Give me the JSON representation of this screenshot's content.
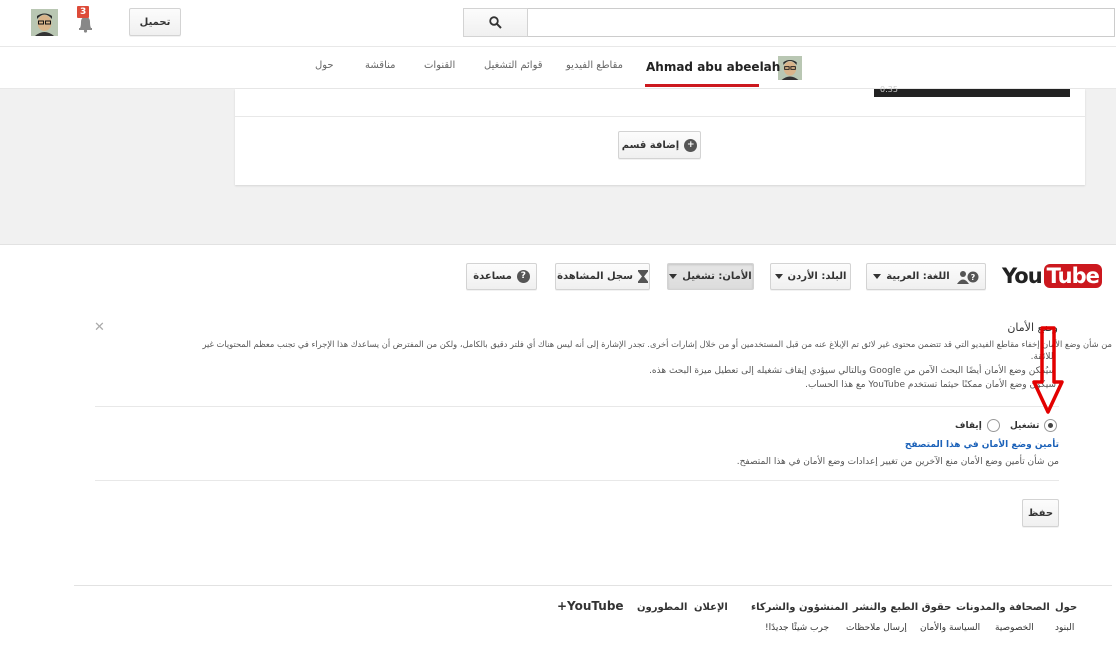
{
  "masthead": {
    "upload_label": "تحميل",
    "notification_count": "3",
    "search_placeholder": ""
  },
  "channel_nav": {
    "channel_name": "Ahmad abu abeelah",
    "tabs": [
      "مقاطع الفيديو",
      "قوائم التشغيل",
      "القنوات",
      "مناقشة",
      "حول"
    ]
  },
  "content": {
    "video_time": "0:35",
    "add_section_label": "إضافة قسم"
  },
  "footer_bar": {
    "logo_you": "You",
    "logo_tube": "Tube",
    "language_label": "اللغة: العربية",
    "country_label": "البلد: الأردن",
    "safety_label": "الأمان: تشغيل",
    "history_label": "سجل المشاهدة",
    "help_label": "مساعدة"
  },
  "safety_panel": {
    "title": "وضع الأمان",
    "p1_line1": "من شأن وضع الأمان إخفاء مقاطع الفيديو التي قد تتضمن محتوى غير لائق تم الإبلاغ عنه من قبل المستخدمين أو من خلال إشارات أخرى. تجدر الإشارة إلى أنه ليس هناك أي فلتر دقيق بالكامل، ولكن من المفترض أن يساعدك هذا الإجراء في تجنب معظم المحتويات غير",
    "p1_line2": "اللائقة.",
    "p2": "سيُمكن وضع الأمان أيضًا البحث الآمن من Google وبالتالي سيؤدي إيقاف تشغيله إلى تعطيل ميزة البحث هذه.",
    "p3": "سيكون وضع الأمان ممكنًا حيثما تستخدم YouTube مع هذا الحساب.",
    "on_label": "تشغيل",
    "off_label": "إيقاف",
    "lock_link": "تأمين وضع الأمان في هذا المتصفح",
    "lock_desc": "من شأن تأمين وضع الأمان منع الآخرين من تغيير إعدادات وضع الأمان في هذا المتصفح.",
    "save_label": "حفظ",
    "selected": "on"
  },
  "footer": {
    "primary_links": [
      "حول",
      "الصحافة والمدونات",
      "حقوق الطبع والنشر",
      "المنشؤون والشركاء",
      "الإعلان",
      "المطورون",
      "+YouTube"
    ],
    "secondary_links": [
      "البنود",
      "الخصوصية",
      "السياسة والأمان",
      "إرسال ملاحظات",
      "جرب شيئًا جديدًا!"
    ]
  },
  "colors": {
    "accent_red": "#cc181e",
    "link_blue": "#1c62b9",
    "annotation_red": "#e30000"
  }
}
